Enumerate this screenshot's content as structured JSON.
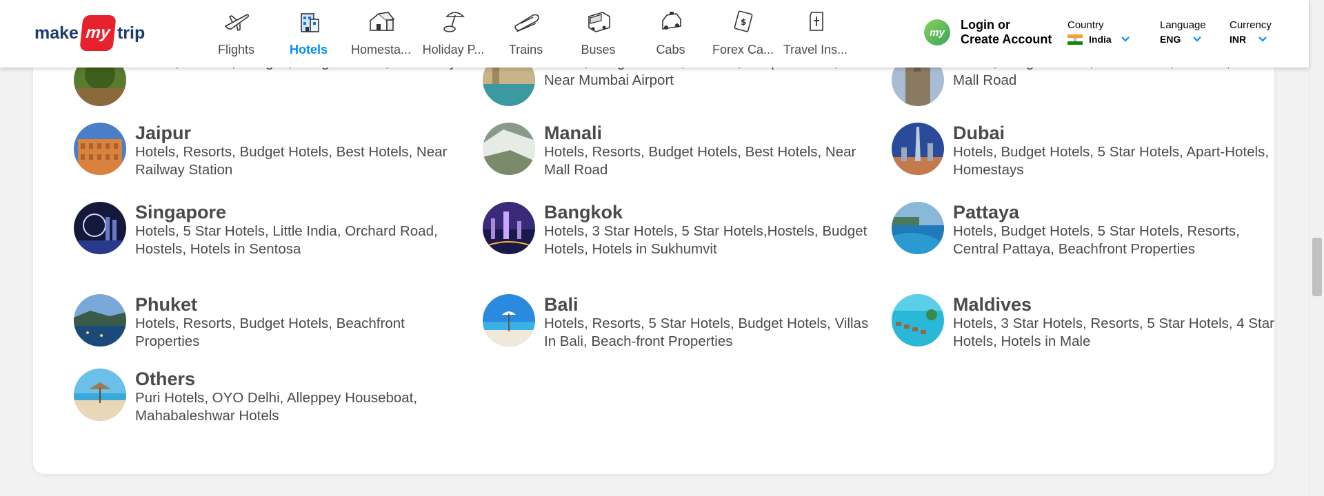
{
  "header": {
    "logo": {
      "left": "make",
      "middle": "my",
      "right": "trip"
    },
    "nav": [
      {
        "label": "Flights",
        "icon": "flight-icon",
        "active": false
      },
      {
        "label": "Hotels",
        "icon": "hotel-icon",
        "active": true
      },
      {
        "label": "Homesta...",
        "icon": "homestay-icon",
        "active": false
      },
      {
        "label": "Holiday P...",
        "icon": "holiday-icon",
        "active": false
      },
      {
        "label": "Trains",
        "icon": "train-icon",
        "active": false
      },
      {
        "label": "Buses",
        "icon": "bus-icon",
        "active": false
      },
      {
        "label": "Cabs",
        "icon": "cab-icon",
        "active": false
      },
      {
        "label": "Forex Ca...",
        "icon": "forex-icon",
        "active": false
      },
      {
        "label": "Travel Ins...",
        "icon": "insurance-icon",
        "active": false
      }
    ],
    "login": {
      "avatar": "my",
      "line1": "Login or",
      "line2": "Create Account"
    },
    "country": {
      "label": "Country",
      "value": "India"
    },
    "language": {
      "label": "Language",
      "value": "ENG"
    },
    "currency": {
      "label": "Currency",
      "value": "INR"
    }
  },
  "cities": [
    {
      "name": "",
      "tags": "Hotels, Resorts, Cottges, Budget Hotels, Homestay"
    },
    {
      "name": "",
      "tags": "Hotels, Budget Hotels, Resorts, Couple Hotels, Near Mumbai Airport"
    },
    {
      "name": "",
      "tags": "Hotels, Budget Hotels, Best Hotels, Resorts, Near Mall Road"
    },
    {
      "name": "Jaipur",
      "tags": "Hotels, Resorts, Budget Hotels, Best Hotels, Near Railway Station"
    },
    {
      "name": "Manali",
      "tags": "Hotels, Resorts, Budget Hotels, Best Hotels, Near Mall Road"
    },
    {
      "name": "Dubai",
      "tags": "Hotels, Budget Hotels, 5 Star Hotels, Apart-Hotels, Homestays"
    },
    {
      "name": "Singapore",
      "tags": "Hotels, 5 Star Hotels, Little India, Orchard Road, Hostels, Hotels in Sentosa"
    },
    {
      "name": "Bangkok",
      "tags": "Hotels, 3 Star Hotels, 5 Star Hotels,Hostels, Budget Hotels, Hotels in Sukhumvit"
    },
    {
      "name": "Pattaya",
      "tags": "Hotels, Budget Hotels, 5 Star Hotels, Resorts, Central Pattaya, Beachfront Properties"
    },
    {
      "name": "Phuket",
      "tags": "Hotels, Resorts, Budget Hotels, Beachfront Properties"
    },
    {
      "name": "Bali",
      "tags": "Hotels, Resorts, 5 Star Hotels, Budget Hotels, Villas In Bali, Beach-front Properties"
    },
    {
      "name": "Maldives",
      "tags": "Hotels, 3 Star Hotels, Resorts, 5 Star Hotels, 4 Star Hotels, Hotels in Male"
    },
    {
      "name": "Others",
      "tags": "Puri Hotels, OYO Delhi, Alleppey Houseboat, Mahabaleshwar Hotels"
    }
  ]
}
